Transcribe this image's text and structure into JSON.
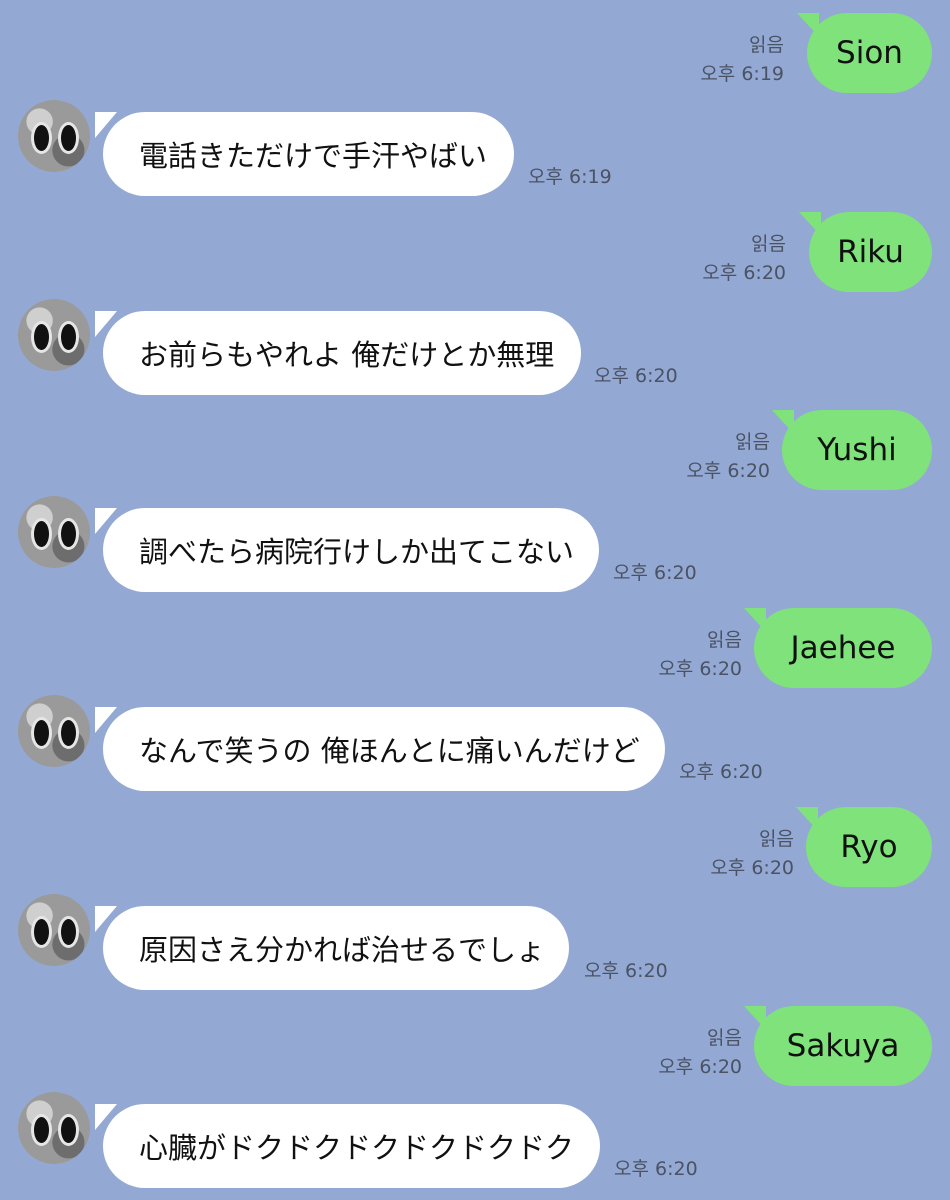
{
  "chat": {
    "messages": [
      {
        "dir": "out",
        "text": "Sion",
        "read": "읽음",
        "time": "오후 6:19"
      },
      {
        "dir": "in",
        "text": "電話きただけで手汗やばい",
        "time": "오후 6:19"
      },
      {
        "dir": "out",
        "text": "Riku",
        "read": "읽음",
        "time": "오후 6:20"
      },
      {
        "dir": "in",
        "text": "お前らもやれよ 俺だけとか無理",
        "time": "오후 6:20"
      },
      {
        "dir": "out",
        "text": "Yushi",
        "read": "읽음",
        "time": "오후 6:20"
      },
      {
        "dir": "in",
        "text": "調べたら病院行けしか出てこない",
        "time": "오후 6:20"
      },
      {
        "dir": "out",
        "text": "Jaehee",
        "read": "읽음",
        "time": "오후 6:20"
      },
      {
        "dir": "in",
        "text": "なんで笑うの 俺ほんとに痛いんだけど",
        "time": "오후 6:20"
      },
      {
        "dir": "out",
        "text": "Ryo",
        "read": "읽음",
        "time": "오후 6:20"
      },
      {
        "dir": "in",
        "text": "原因さえ分かれば治せるでしょ",
        "time": "오후 6:20"
      },
      {
        "dir": "out",
        "text": "Sakuya",
        "read": "읽음",
        "time": "오후 6:20"
      },
      {
        "dir": "in",
        "text": "心臓がドクドクドクドクドクドク",
        "time": "오후 6:20"
      }
    ]
  }
}
